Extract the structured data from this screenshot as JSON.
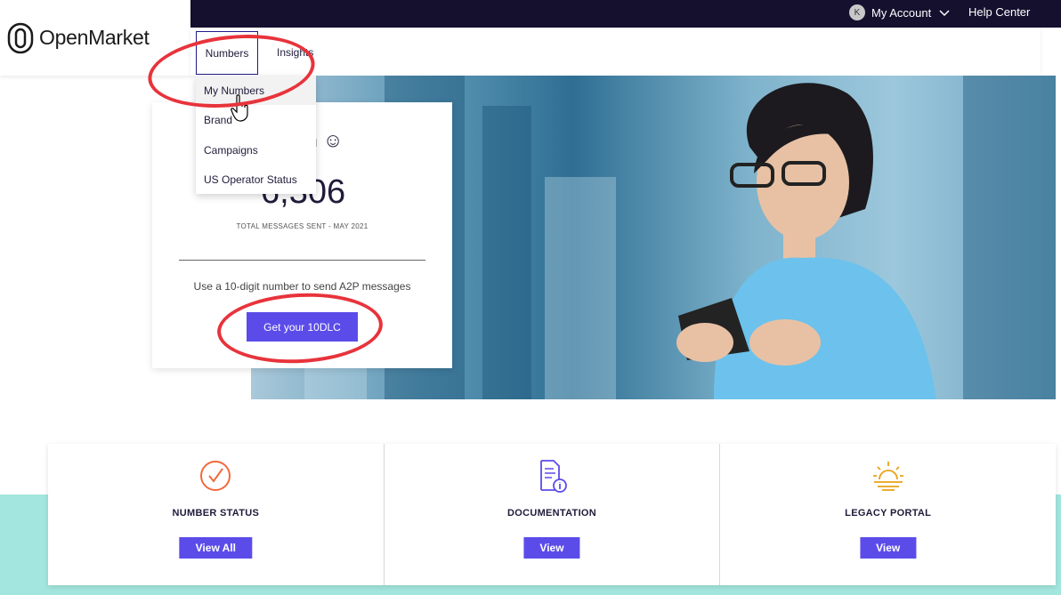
{
  "brand": {
    "name": "OpenMarket"
  },
  "topbar": {
    "avatar_initial": "K",
    "account_label": "My Account",
    "help_label": "Help Center"
  },
  "nav": {
    "numbers_label": "Numbers",
    "insights_label": "Insights"
  },
  "dropdown": {
    "items": [
      "My Numbers",
      "Brand",
      "Campaigns",
      "US Operator Status"
    ]
  },
  "card": {
    "greeting": "en",
    "greeting_emoji": "☺",
    "total_messages": "6,306",
    "total_caption": "TOTAL MESSAGES SENT - MAY 2021",
    "hint": "Use a 10-digit number to send A2P messages",
    "cta_label": "Get your 10DLC"
  },
  "tiles": [
    {
      "title": "NUMBER STATUS",
      "button": "View All",
      "icon": "check-circle-icon",
      "color": "#f06a3b"
    },
    {
      "title": "DOCUMENTATION",
      "button": "View",
      "icon": "document-info-icon",
      "color": "#5b4cea"
    },
    {
      "title": "LEGACY PORTAL",
      "button": "View",
      "icon": "sunrise-icon",
      "color": "#e8a317"
    }
  ],
  "colors": {
    "accent": "#5b4cea",
    "topbar": "#14102e",
    "annotation": "#e8333b",
    "teal": "#a3e6df"
  }
}
